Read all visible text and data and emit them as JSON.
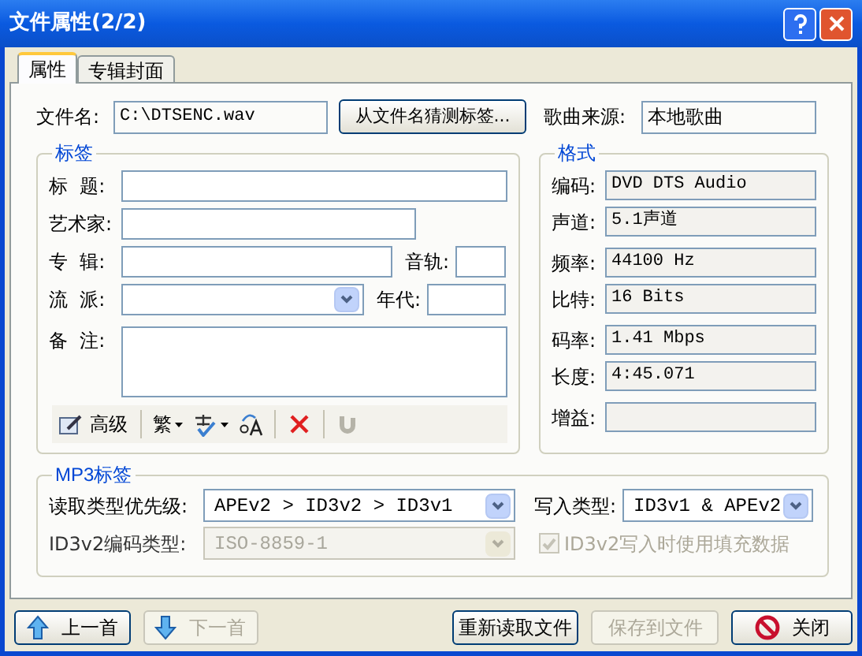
{
  "window": {
    "title": "文件属性(2/2)"
  },
  "tabs": [
    {
      "label": "属性",
      "selected": true
    },
    {
      "label": "专辑封面",
      "selected": false
    }
  ],
  "file": {
    "label": "文件名:",
    "value": "C:\\DTSENC.wav",
    "guess_button": "从文件名猜测标签...",
    "source_label": "歌曲来源:",
    "source_value": "本地歌曲"
  },
  "tag_group": {
    "title": "标签",
    "rows": [
      {
        "fields": [
          {
            "label": "标  题:",
            "kind": "text"
          }
        ]
      },
      {
        "fields": [
          {
            "label": "艺术家:",
            "kind": "text"
          }
        ]
      },
      {
        "fields": [
          {
            "label": "专  辑:",
            "kind": "text"
          },
          {
            "label": "音轨:",
            "kind": "text"
          }
        ]
      },
      {
        "fields": [
          {
            "label": "流  派:",
            "kind": "combo"
          },
          {
            "label": "年代:",
            "kind": "text"
          }
        ]
      },
      {
        "fields": [
          {
            "label": "备  注:",
            "kind": "textarea"
          }
        ]
      }
    ],
    "toolbar": [
      {
        "kind": "advanced",
        "label": "高级"
      },
      {
        "kind": "separator"
      },
      {
        "kind": "convert",
        "label": "繁"
      },
      {
        "kind": "spell"
      },
      {
        "kind": "case"
      },
      {
        "kind": "separator"
      },
      {
        "kind": "delete"
      },
      {
        "kind": "separator"
      },
      {
        "kind": "undo",
        "disabled": true
      }
    ]
  },
  "format_group": {
    "title": "格式",
    "rows": [
      {
        "label": "编码:",
        "value": "DVD DTS Audio"
      },
      {
        "label": "声道:",
        "value": "5.1声道"
      },
      {
        "label": "频率:",
        "value": "44100 Hz"
      },
      {
        "label": "比特:",
        "value": "16 Bits"
      },
      {
        "label": "码率:",
        "value": "1.41 Mbps"
      },
      {
        "label": "长度:",
        "value": "4:45.071"
      },
      {
        "label": "增益:"
      }
    ]
  },
  "mp3_group": {
    "title": "MP3标签",
    "read_priority": {
      "label": "读取类型优先级:",
      "value": "APEv2 > ID3v2 > ID3v1",
      "disabled": false
    },
    "write_type": {
      "label": "写入类型:",
      "value": "ID3v1 & APEv2",
      "disabled": false
    },
    "encoding": {
      "label": "ID3v2编码类型:",
      "value": "ISO-8859-1",
      "disabled": true
    },
    "padding": {
      "label": "ID3v2写入时使用填充数据",
      "checked": true,
      "disabled": true
    }
  },
  "buttons": [
    {
      "label": "上一首",
      "kind": "up",
      "disabled": false
    },
    {
      "label": "下一首",
      "kind": "down",
      "disabled": true
    },
    {
      "label": "重新读取文件",
      "kind": "plain",
      "disabled": false
    },
    {
      "label": "保存到文件",
      "kind": "plain",
      "disabled": true
    },
    {
      "label": "关闭",
      "kind": "close",
      "disabled": false
    }
  ]
}
